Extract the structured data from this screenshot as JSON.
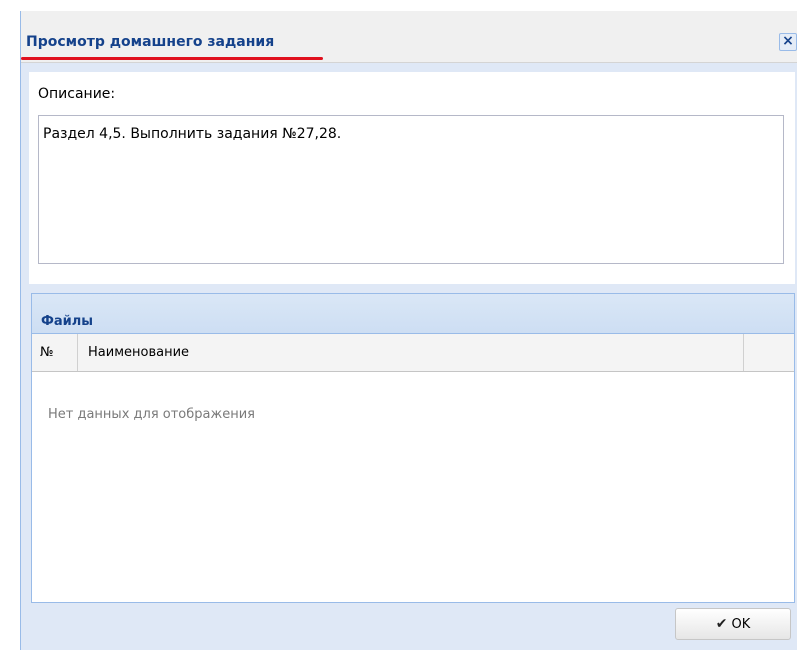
{
  "dialog": {
    "title": "Просмотр домашнего задания",
    "close_symbol": "×"
  },
  "description": {
    "label": "Описание:",
    "value": "Раздел 4,5. Выполнить задания №27,28."
  },
  "files": {
    "title": "Файлы",
    "columns": [
      "№",
      "Наименование",
      ""
    ],
    "empty_text": "Нет данных для отображения"
  },
  "footer": {
    "ok_label": "OK",
    "ok_icon": "check-icon"
  },
  "colors": {
    "title_text": "#15428b",
    "title_underline": "#e0101e",
    "window_background": "#dfe8f6",
    "panel_border": "#99bbe8"
  }
}
